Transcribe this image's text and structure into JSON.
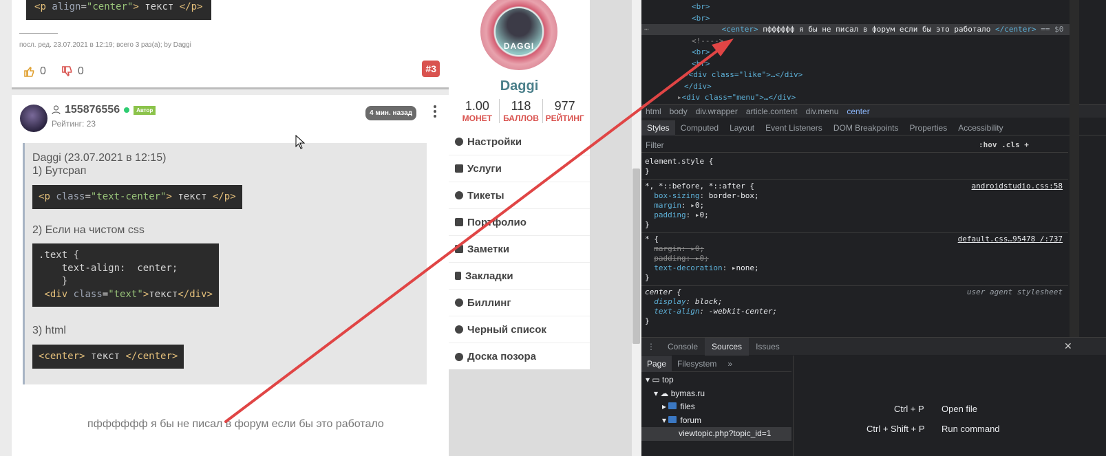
{
  "top_post": {
    "code": {
      "tag": "p",
      "attr": "align",
      "value": "\"center\"",
      "text": " текст "
    },
    "edit_note": "посл. ред. 23.07.2021 в 12:19; всего 3 раз(а); by Daggi",
    "likes": "0",
    "dislikes": "0",
    "post_number": "#3"
  },
  "main_post": {
    "username": "155876556",
    "author_badge": "Автор",
    "rating": "Рейтинг: 23",
    "time_ago": "4 мин. назад",
    "quote": {
      "header": "Daggi (23.07.2021 в 12:15)",
      "item1": "1) Бутсрап",
      "code1": {
        "tag": "p",
        "attr": "class",
        "value": "\"text-center\"",
        "text": " текст "
      },
      "item2": "2) Если на чистом css",
      "code2_line1": ".text {",
      "code2_line2": "    text-align:  center;",
      "code2_line3": "    }",
      "code2_line4_tag": "div",
      "code2_line4_attr": "class",
      "code2_line4_value": "\"text\"",
      "code2_line4_text": "текст",
      "item3": "3) html",
      "code3": {
        "tag": "center",
        "text": " текст "
      }
    },
    "reply": "пфффффф я бы не писал в форум если бы это работало"
  },
  "profile": {
    "avatar_text": "DAGGI",
    "name": "Daggi",
    "stats": [
      {
        "value": "1.00",
        "label": "МОНЕТ"
      },
      {
        "value": "118",
        "label": "БАЛЛОВ"
      },
      {
        "value": "977",
        "label": "РЕЙТИНГ"
      }
    ],
    "menu": [
      {
        "label": "Настройки",
        "icon": "gear-icon"
      },
      {
        "label": "Услуги",
        "icon": "cart-icon"
      },
      {
        "label": "Тикеты",
        "icon": "users-icon"
      },
      {
        "label": "Портфолио",
        "icon": "briefcase-icon"
      },
      {
        "label": "Заметки",
        "icon": "notes-icon"
      },
      {
        "label": "Закладки",
        "icon": "bookmark-icon"
      },
      {
        "label": "Биллинг",
        "icon": "dollar-icon"
      },
      {
        "label": "Черный список",
        "icon": "user-icon"
      },
      {
        "label": "Доска позора",
        "icon": "alert-icon"
      }
    ]
  },
  "devtools": {
    "dom": {
      "br": "<br>",
      "center_text": "пфффффф я бы не писал в форум если бы это работало",
      "eq": "== $0",
      "comment": "<!---->",
      "like_div": "<div class=\"like\">…</div>",
      "div_close": "</div>",
      "menu_div": "<div class=\"menu\">…</div>",
      "center_open": "<center>",
      "center_close": "</center>",
      "dots": "⋯"
    },
    "breadcrumbs": [
      "html",
      "body",
      "div.wrapper",
      "article.content",
      "div.menu",
      "center"
    ],
    "tabs": [
      "Styles",
      "Computed",
      "Layout",
      "Event Listeners",
      "DOM Breakpoints",
      "Properties",
      "Accessibility"
    ],
    "filter_placeholder": "Filter",
    "filter_tools": ":hov  .cls  +",
    "rules": {
      "element_style": "element.style {",
      "close": "}",
      "r1_sel": "*, *::before, *::after {",
      "r1_src": "androidstudio.css:58",
      "r1_p1": "box-sizing",
      "r1_v1": "border-box;",
      "r1_p2": "margin",
      "r1_v2": "0;",
      "r1_p3": "padding",
      "r1_v3": "0;",
      "r2_sel": "* {",
      "r2_src": "default.css…95478 /:737",
      "r2_p1": "margin",
      "r2_v1": "0;",
      "r2_p2": "padding",
      "r2_v2": "0;",
      "r2_p3": "text-decoration",
      "r2_v3": "none;",
      "r3_sel": "center {",
      "r3_src": "user agent stylesheet",
      "r3_p1": "display",
      "r3_v1": "block;",
      "r3_p2": "text-align",
      "r3_v2": "-webkit-center;"
    },
    "drawer_tabs": [
      "Console",
      "Sources",
      "Issues"
    ],
    "nav_tabs": [
      "Page",
      "Filesystem"
    ],
    "tree": [
      "top",
      "bymas.ru",
      "files",
      "forum",
      "viewtopic.php?topic_id=1"
    ],
    "shortcuts": [
      {
        "keys": "Ctrl + P",
        "label": "Open file"
      },
      {
        "keys": "Ctrl + Shift + P",
        "label": "Run command"
      }
    ]
  },
  "colors": {
    "annotation_arrow": "#e04545",
    "post_number": "#d9534f",
    "accent_name": "#4a7f8a"
  }
}
